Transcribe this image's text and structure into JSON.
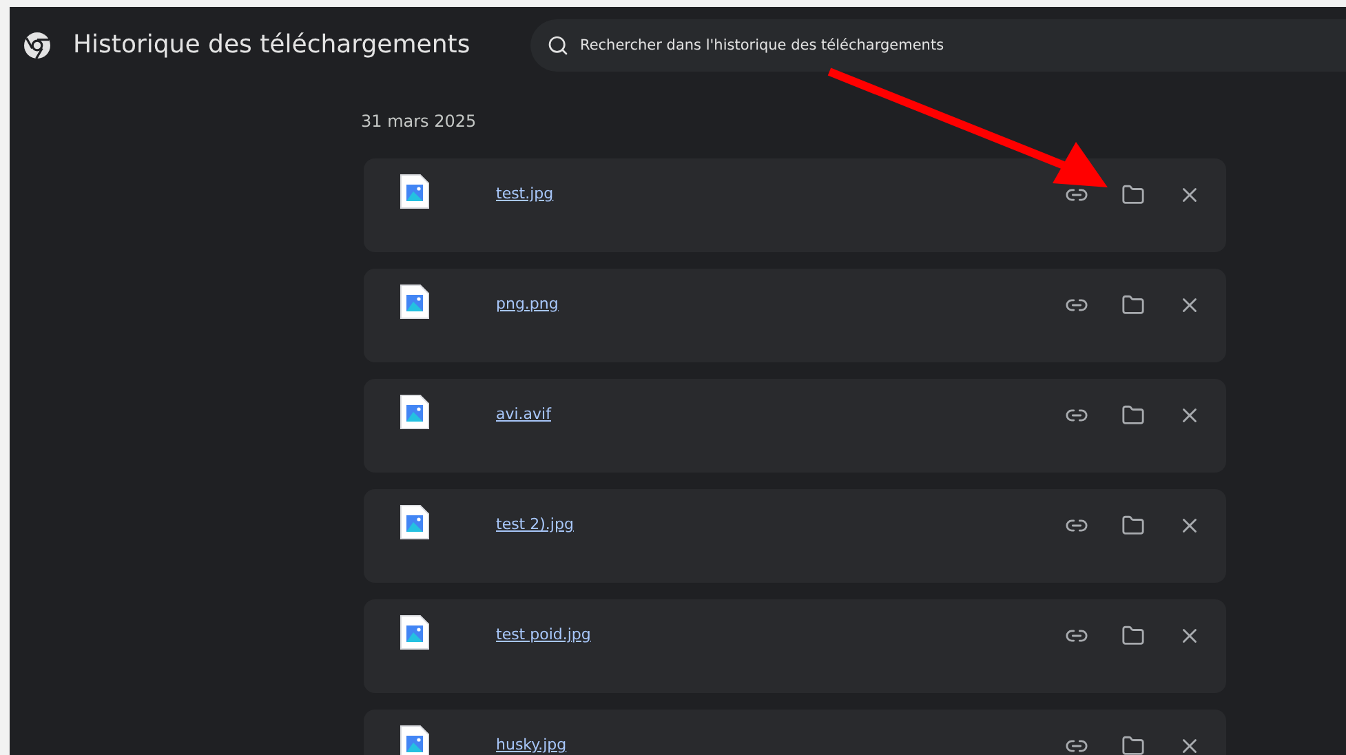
{
  "header": {
    "title": "Historique des téléchargements",
    "search": {
      "placeholder": "Rechercher dans l'historique des téléchargements"
    }
  },
  "date_group": {
    "label": "31 mars 2025"
  },
  "downloads": [
    {
      "name": "test.jpg"
    },
    {
      "name": "png.png"
    },
    {
      "name": "avi.avif"
    },
    {
      "name": "test 2).jpg"
    },
    {
      "name": "test poid.jpg"
    },
    {
      "name": "husky.jpg"
    }
  ]
}
